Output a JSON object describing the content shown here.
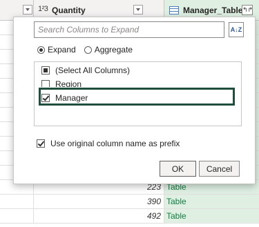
{
  "grid": {
    "columns": [
      {
        "type_icon": "1²3",
        "title": "Quantity"
      },
      {
        "type_icon": "table-icon",
        "title": "Manager_Table"
      }
    ],
    "rows": [
      {
        "quantity": "",
        "manager": ""
      },
      {
        "quantity": "",
        "manager": ""
      },
      {
        "quantity": "",
        "manager": ""
      },
      {
        "quantity": "",
        "manager": ""
      },
      {
        "quantity": "",
        "manager": ""
      },
      {
        "quantity": "",
        "manager": ""
      },
      {
        "quantity": "",
        "manager": ""
      },
      {
        "quantity": "",
        "manager": ""
      },
      {
        "quantity": "",
        "manager": ""
      },
      {
        "quantity": "",
        "manager": ""
      },
      {
        "quantity": "",
        "manager": ""
      },
      {
        "quantity": "223",
        "manager": "Table"
      },
      {
        "quantity": "390",
        "manager": "Table"
      },
      {
        "quantity": "492",
        "manager": "Table"
      }
    ],
    "expand_icon": "↰↱"
  },
  "popup": {
    "search_placeholder": "Search Columns to Expand",
    "sort_icon": "A↓Z",
    "mode_options": [
      {
        "label": "Expand",
        "selected": true
      },
      {
        "label": "Aggregate",
        "selected": false
      }
    ],
    "columns": [
      {
        "label": "(Select All Columns)",
        "state": "partial"
      },
      {
        "label": "Region",
        "state": "unchecked"
      },
      {
        "label": "Manager",
        "state": "checked"
      }
    ],
    "prefix_label": "Use original column name as prefix",
    "prefix_checked": true,
    "ok_label": "OK",
    "cancel_label": "Cancel"
  },
  "colors": {
    "highlight_border": "#1f4e3d",
    "table_column_bg": "#dff0e3",
    "table_text": "#107c41"
  }
}
